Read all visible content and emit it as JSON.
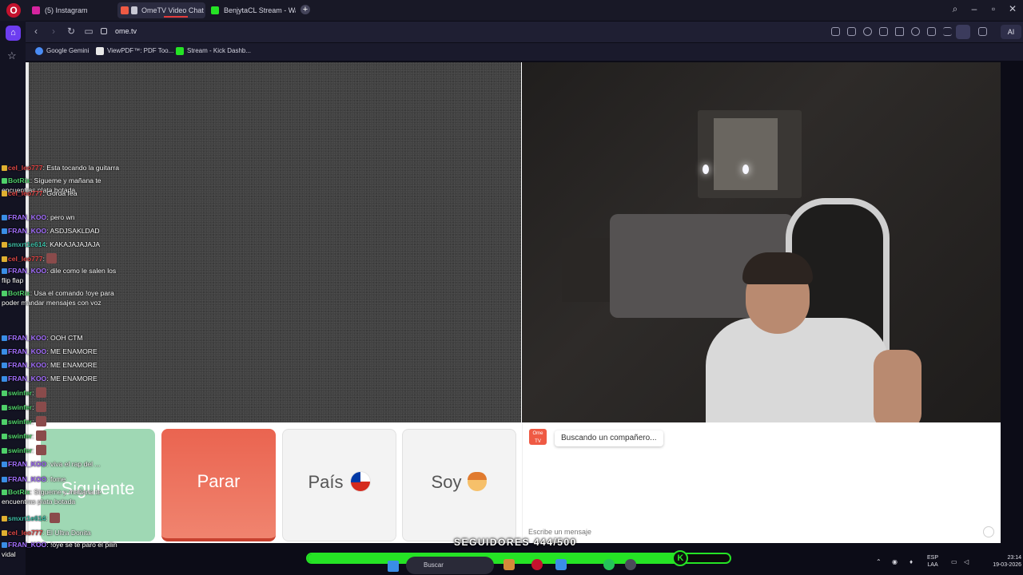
{
  "browser": {
    "tabs": [
      {
        "label": "(5) Instagram",
        "color": "#d6249f"
      },
      {
        "label": "OmeTV Video Chat -",
        "color": "#ef5a44",
        "active": true
      },
      {
        "label": "BenjytaCL Stream - Watch",
        "color": "#25e325"
      }
    ],
    "url": "ome.tv",
    "ai_label": "AI",
    "bookmarks": [
      {
        "label": "Google Gemini",
        "color": "#4a8cf5"
      },
      {
        "label": "ViewPDF™: PDF Too...",
        "color": "#e8e8e8"
      },
      {
        "label": "Stream - Kick Dashb...",
        "color": "#25e325"
      }
    ]
  },
  "ometv": {
    "buttons": {
      "next": "Siguiente",
      "stop": "Parar",
      "country": "País",
      "gender": "Soy"
    },
    "logo_text": "Ome TV",
    "status_message": "Buscando un compañero...",
    "message_placeholder": "Escribe un mensaje"
  },
  "stream_chat": [
    {
      "user": "cel_leo777",
      "text": "Esta tocando la guitarra",
      "color": "red"
    },
    {
      "user": "BotRix",
      "text": "Sígueme y mañana te encuentras plata botada",
      "color": "green"
    },
    {
      "user": "cel_leo777",
      "text": "Gorda fea",
      "color": "red"
    },
    {
      "user": "FRAN_KOO",
      "text": "pero wn",
      "color": "purple"
    },
    {
      "user": "FRAN_KOO",
      "text": "ASDJSAKLDAD",
      "color": "purple"
    },
    {
      "user": "smxrt1e614",
      "text": "KAKAJAJAJAJA",
      "color": "teal"
    },
    {
      "user": "cel_leo777",
      "text": "",
      "color": "red"
    },
    {
      "user": "FRAN_KOO",
      "text": "dile como le salen los flip flap",
      "color": "purple"
    },
    {
      "user": "BotRix",
      "text": "Usa el comando !oye para poder mandar mensajes con voz",
      "color": "green"
    },
    {
      "user": "FRAN_KOO",
      "text": "OOH CTM",
      "color": "purple"
    },
    {
      "user": "FRAN_KOO",
      "text": "ME ENAMORE",
      "color": "purple"
    },
    {
      "user": "FRAN_KOO",
      "text": "ME ENAMORE",
      "color": "purple"
    },
    {
      "user": "FRAN_KOO",
      "text": "ME ENAMORE",
      "color": "purple"
    },
    {
      "user": "swinfer",
      "text": "",
      "color": "green"
    },
    {
      "user": "swinfer",
      "text": "",
      "color": "green"
    },
    {
      "user": "swinfer",
      "text": "",
      "color": "green"
    },
    {
      "user": "swinfer",
      "text": "",
      "color": "green"
    },
    {
      "user": "swinfer",
      "text": "",
      "color": "green"
    },
    {
      "user": "FRAN_KOO",
      "text": "viva el rap del ...",
      "color": "purple"
    },
    {
      "user": "FRAN_KOO",
      "text": "fome",
      "color": "purple"
    },
    {
      "user": "BotRix",
      "text": "Sígueme y mañana te encuentras plata botada",
      "color": "green"
    },
    {
      "user": "smxrt1e614",
      "text": "",
      "color": "teal"
    },
    {
      "user": "cel_leo777",
      "text": "El Ultra Donita",
      "color": "red"
    },
    {
      "user": "FRAN_KOO",
      "text": "!oye se te paro el pilin vidal",
      "color": "purple"
    }
  ],
  "overlay": {
    "followers_text": "SEGUIDORES 444/500",
    "followers_current": 444,
    "followers_goal": 500,
    "progress_fraction": 0.888,
    "accent": "#25e325"
  },
  "taskbar": {
    "search_placeholder": "Buscar",
    "lang_top": "ESP",
    "lang_bottom": "LAA",
    "time": "23:14",
    "date": "19-03-2026"
  }
}
